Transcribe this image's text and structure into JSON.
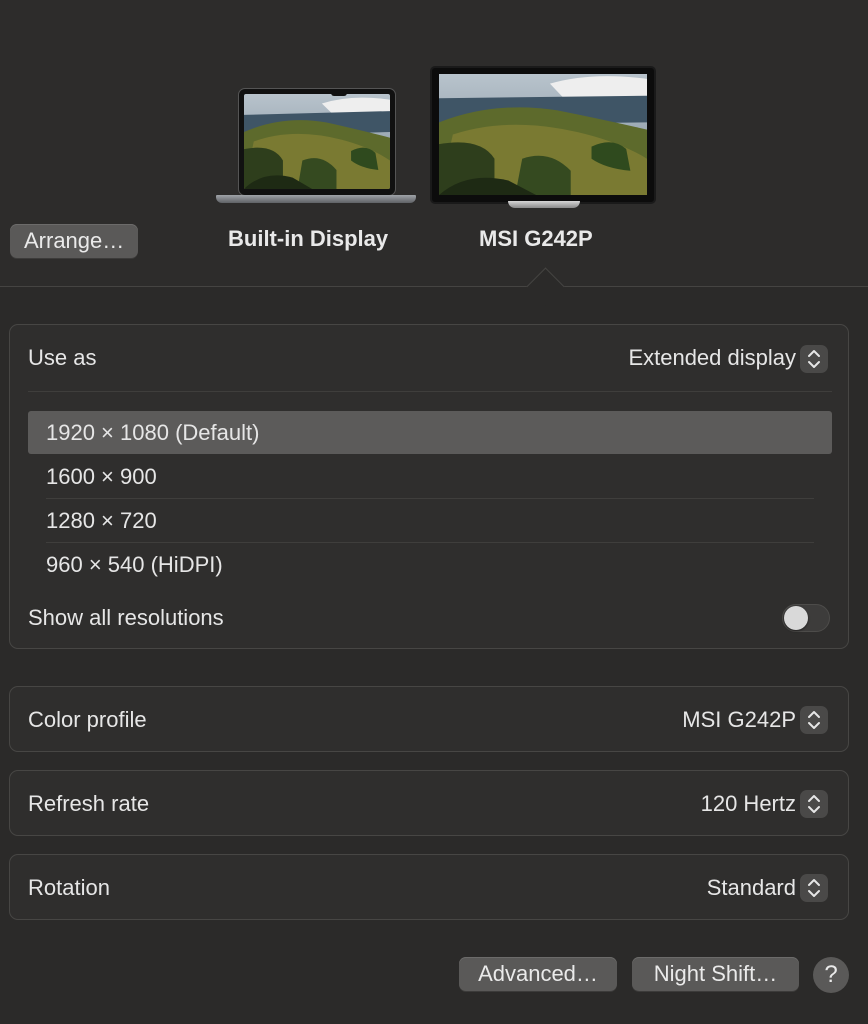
{
  "displays": {
    "arrange_label": "Arrange…",
    "builtin_label": "Built-in Display",
    "external_label": "MSI G242P"
  },
  "settings": {
    "use_as_label": "Use as",
    "use_as_value": "Extended display",
    "resolutions": [
      "1920 × 1080 (Default)",
      "1600 × 900",
      "1280 × 720",
      "960 × 540 (HiDPI)"
    ],
    "selected_resolution": "1920 × 1080 (Default)",
    "show_all_label": "Show all resolutions",
    "show_all_enabled": false,
    "color_profile_label": "Color profile",
    "color_profile_value": "MSI G242P",
    "refresh_rate_label": "Refresh rate",
    "refresh_rate_value": "120 Hertz",
    "rotation_label": "Rotation",
    "rotation_value": "Standard"
  },
  "footer": {
    "advanced_label": "Advanced…",
    "night_shift_label": "Night Shift…",
    "help_label": "?"
  },
  "icons": {
    "stepper": "up-down-chevron-icon",
    "laptop": "laptop-icon",
    "monitor": "monitor-icon",
    "help": "question-mark-icon"
  },
  "colors": {
    "background": "#2b2a29",
    "group_background": "#2f2e2d",
    "button": "#5a5958",
    "selected_row": "#5c5b5a"
  }
}
